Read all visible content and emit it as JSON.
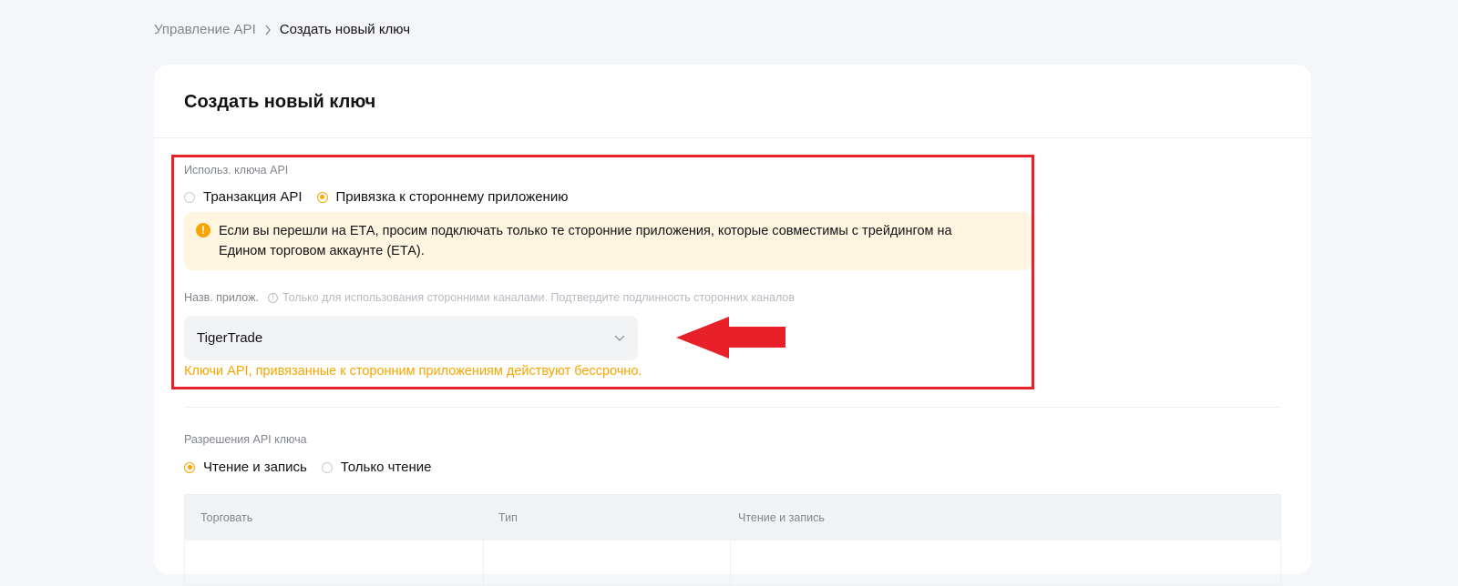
{
  "breadcrumb": {
    "parent": "Управление API",
    "current": "Создать новый ключ"
  },
  "page": {
    "title": "Создать новый ключ"
  },
  "key_usage": {
    "label": "Использ. ключа API",
    "options": [
      {
        "label": "Транзакция API",
        "checked": false
      },
      {
        "label": "Привязка к стороннему приложению",
        "checked": true
      }
    ],
    "notice": "Если вы перешли на ЕТА, просим подключать только те сторонние приложения, которые совместимы с трейдингом на Едином торговом аккаунте (ЕТА).",
    "notice_icon": "warning-icon"
  },
  "app_name": {
    "label": "Назв. прилож.",
    "hint": "Только для использования сторонними каналами. Подтвердите подлинность сторонних каналов",
    "selected": "TigerTrade",
    "validity_note": "Ключи API, привязанные к сторонним приложениям действуют бессрочно."
  },
  "permissions": {
    "label": "Разрешения API ключа",
    "options": [
      {
        "label": "Чтение и запись",
        "checked": true
      },
      {
        "label": "Только чтение",
        "checked": false
      }
    ]
  },
  "table": {
    "columns": [
      "Торговать",
      "Тип",
      "Чтение и запись"
    ]
  },
  "colors": {
    "accent": "#f7a600",
    "annotation_red": "#e8202a",
    "notice_bg": "#fff5e0"
  }
}
